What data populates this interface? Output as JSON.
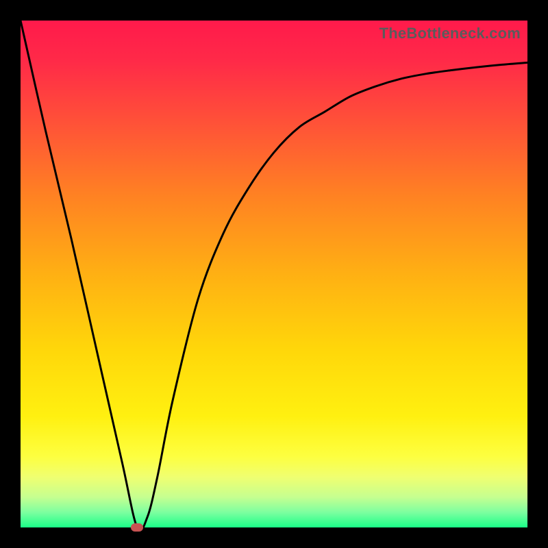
{
  "watermark": "TheBottleneck.com",
  "chart_data": {
    "type": "line",
    "title": "",
    "xlabel": "",
    "ylabel": "",
    "xlim": [
      0,
      100
    ],
    "ylim": [
      0,
      100
    ],
    "grid": false,
    "legend": false,
    "series": [
      {
        "name": "bottleneck-curve",
        "x": [
          0,
          5,
          10,
          15,
          20,
          23,
          25,
          27,
          30,
          35,
          40,
          45,
          50,
          55,
          60,
          65,
          70,
          75,
          80,
          85,
          90,
          95,
          100
        ],
        "y": [
          100,
          78,
          57,
          35,
          13,
          0,
          2,
          10,
          25,
          45,
          58,
          67,
          74,
          79,
          82,
          85,
          87,
          88.5,
          89.5,
          90.2,
          90.8,
          91.3,
          91.7
        ]
      }
    ],
    "marker": {
      "x": 23,
      "y": 0,
      "color": "#c75353"
    },
    "background_gradient": {
      "stops": [
        {
          "offset": 0.0,
          "color": "#ff1a4b"
        },
        {
          "offset": 0.08,
          "color": "#ff2a48"
        },
        {
          "offset": 0.2,
          "color": "#ff5138"
        },
        {
          "offset": 0.35,
          "color": "#ff8322"
        },
        {
          "offset": 0.5,
          "color": "#ffb013"
        },
        {
          "offset": 0.65,
          "color": "#ffd70a"
        },
        {
          "offset": 0.78,
          "color": "#fff010"
        },
        {
          "offset": 0.86,
          "color": "#fdff40"
        },
        {
          "offset": 0.9,
          "color": "#f0ff70"
        },
        {
          "offset": 0.94,
          "color": "#c6ff90"
        },
        {
          "offset": 0.97,
          "color": "#7dffa0"
        },
        {
          "offset": 1.0,
          "color": "#1aff88"
        }
      ]
    },
    "curve_color": "#000000",
    "curve_width": 3
  },
  "layout": {
    "outer_size": 800,
    "plot_inset": 30
  }
}
